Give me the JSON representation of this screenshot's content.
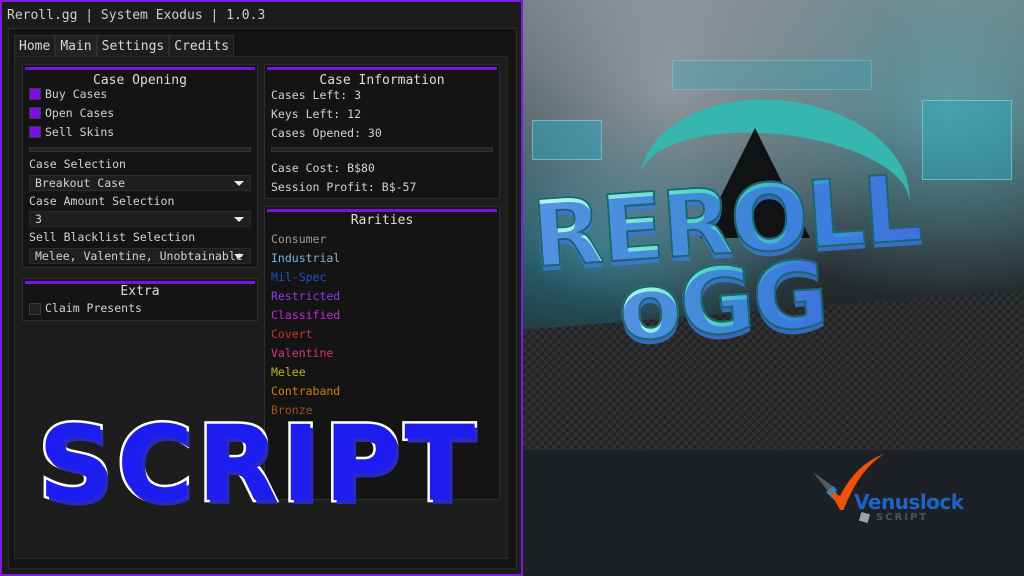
{
  "window": {
    "title": "Reroll.gg | System Exodus | 1.0.3",
    "accent_color": "#7a10e8"
  },
  "tabs": [
    {
      "label": "Home",
      "active": false
    },
    {
      "label": "Main",
      "active": true
    },
    {
      "label": "Settings",
      "active": false
    },
    {
      "label": "Credits",
      "active": false
    }
  ],
  "case_opening": {
    "title": "Case Opening",
    "toggles": [
      {
        "label": "Buy Cases",
        "checked": true
      },
      {
        "label": "Open Cases",
        "checked": true
      },
      {
        "label": "Sell Skins",
        "checked": true
      }
    ],
    "case_selection": {
      "label": "Case Selection",
      "value": "Breakout Case"
    },
    "case_amount": {
      "label": "Case Amount Selection",
      "value": "3"
    },
    "sell_blacklist": {
      "label": "Sell Blacklist Selection",
      "value": "Melee, Valentine, Unobtainable, "
    }
  },
  "extra": {
    "title": "Extra",
    "toggles": [
      {
        "label": "Claim Presents",
        "checked": false
      }
    ]
  },
  "case_information": {
    "title": "Case Information",
    "cases_left": "Cases Left: 3",
    "keys_left": "Keys Left: 12",
    "cases_opened": "Cases Opened: 30",
    "case_cost": "Case Cost: B$80",
    "session_profit": "Session Profit: B$-57"
  },
  "rarities": {
    "title": "Rarities",
    "items": [
      {
        "label": "Consumer",
        "color": "#9a9a9a"
      },
      {
        "label": "Industrial",
        "color": "#7ab4e0"
      },
      {
        "label": "Mil-Spec",
        "color": "#2050c8"
      },
      {
        "label": "Restricted",
        "color": "#8a3ce0"
      },
      {
        "label": "Classified",
        "color": "#c22ad8"
      },
      {
        "label": "Covert",
        "color": "#d03030"
      },
      {
        "label": "Valentine",
        "color": "#e0307a"
      },
      {
        "label": "Melee",
        "color": "#c8b020"
      },
      {
        "label": "Contraband",
        "color": "#d87a10"
      },
      {
        "label": "Bronze",
        "color": "#a0521c"
      }
    ]
  },
  "overlay": {
    "script_label": "SCRIPT",
    "game_logo_line1": "REROLL",
    "game_logo_line2": "oGG",
    "brand_name": "Venuslock",
    "brand_sub": "SCRIPT"
  }
}
